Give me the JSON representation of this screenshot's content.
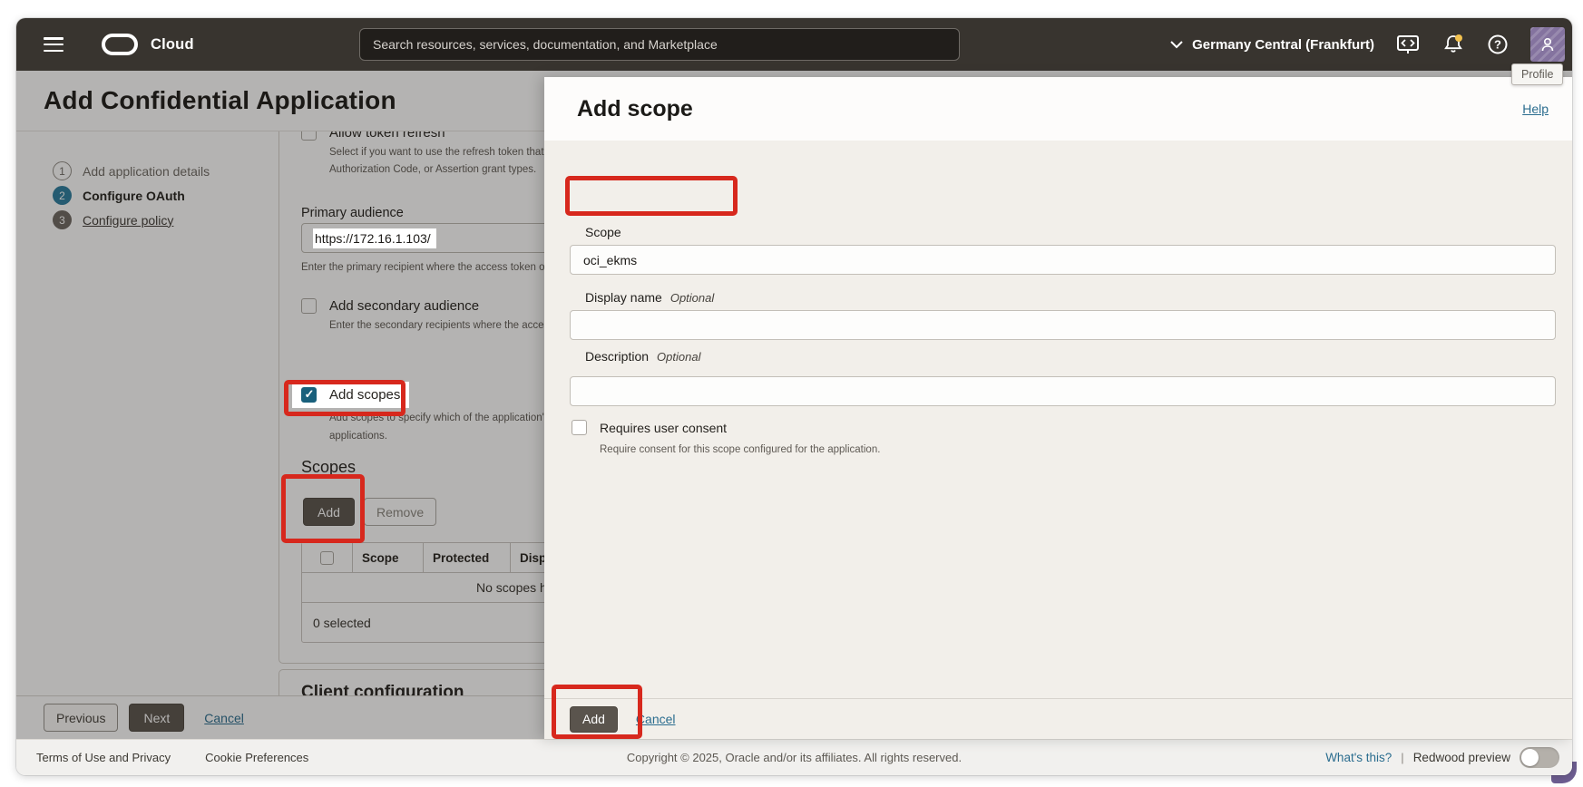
{
  "topbar": {
    "brand": "Cloud",
    "search_placeholder": "Search resources, services, documentation, and Marketplace",
    "region": "Germany Central (Frankfurt)",
    "profile_tooltip": "Profile"
  },
  "wizard": {
    "title": "Add Confidential Application",
    "steps": [
      {
        "num": "1",
        "label": "Add application details"
      },
      {
        "num": "2",
        "label": "Configure OAuth"
      },
      {
        "num": "3",
        "label": "Configure policy"
      }
    ],
    "form": {
      "allow_token_refresh_label": "Allow token refresh",
      "allow_token_refresh_help1": "Select if you want to use the refresh token that you",
      "allow_token_refresh_help2": "Authorization Code, or Assertion grant types.",
      "primary_audience_label": "Primary audience",
      "primary_audience_value": "https://172.16.1.103/",
      "primary_audience_help": "Enter the primary recipient where the access token of yo",
      "secondary_audience_label": "Add secondary audience",
      "secondary_audience_help": "Enter the secondary recipients where the access to",
      "add_scopes_label": "Add scopes",
      "add_scopes_checked": true,
      "add_scopes_help1": "Add scopes to specify which of the application's re",
      "add_scopes_help2": "applications.",
      "scopes_heading": "Scopes",
      "add_button": "Add",
      "remove_button": "Remove",
      "table_headers": [
        "Scope",
        "Protected",
        "Display name"
      ],
      "table_empty": "No scopes have been added.",
      "selected_count": "0 selected",
      "next_section_heading": "Client configuration"
    },
    "footer": {
      "previous": "Previous",
      "next": "Next",
      "cancel": "Cancel"
    }
  },
  "dialog": {
    "title": "Add scope",
    "help_link": "Help",
    "scope_label": "Scope",
    "scope_value": "oci_ekms",
    "display_name_label": "Display name",
    "optional": "Optional",
    "description_label": "Description",
    "consent_label": "Requires user consent",
    "consent_checked": false,
    "consent_help": "Require consent for this scope configured for the application.",
    "add_button": "Add",
    "cancel_link": "Cancel"
  },
  "footer": {
    "terms": "Terms of Use and Privacy",
    "cookies": "Cookie Preferences",
    "copyright": "Copyright © 2025, Oracle and/or its affiliates. All rights reserved.",
    "whats_this": "What's this?",
    "redwood": "Redwood preview"
  }
}
